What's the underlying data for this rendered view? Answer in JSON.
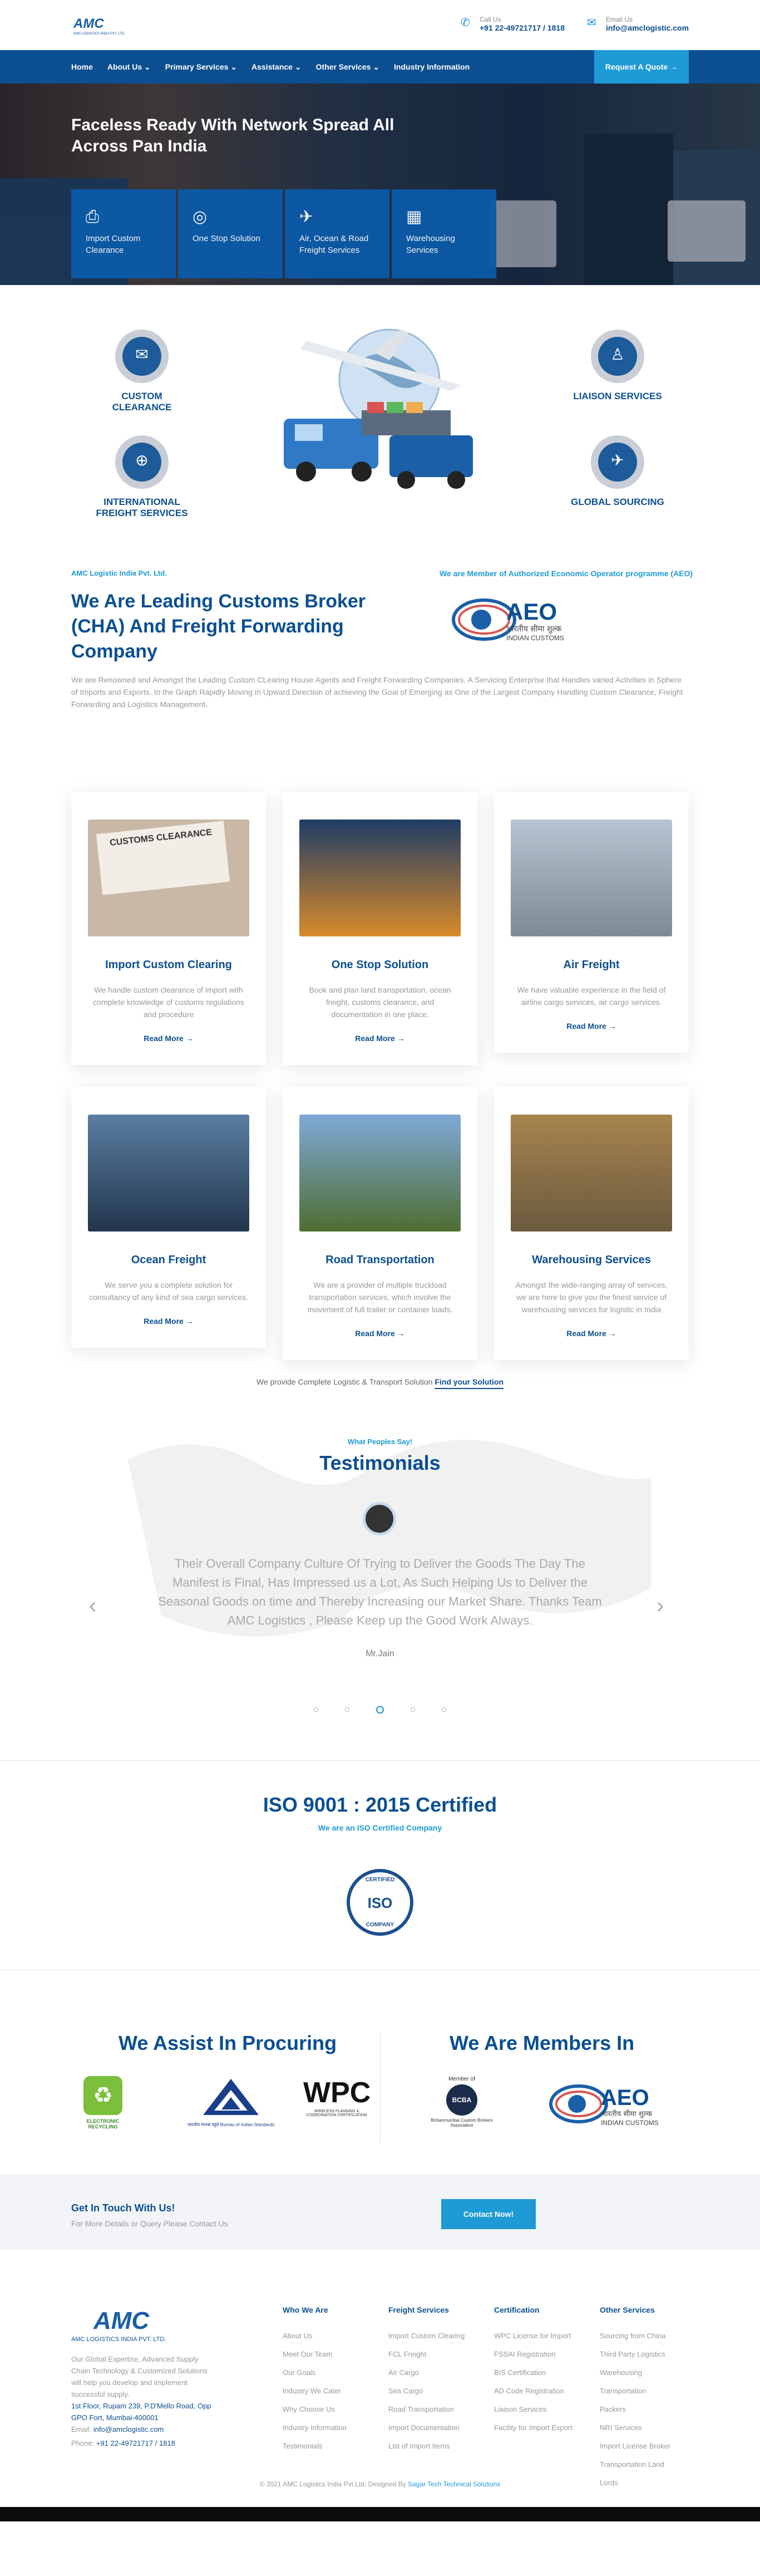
{
  "header": {
    "logo_text": "AMC LOGISTICS INDIA PVT. LTD.",
    "call_label": "Call Us",
    "call_value": "+91 22-49721717 / 1818",
    "email_label": "Email Us",
    "email_value": "info@amclogistic.com"
  },
  "nav": {
    "items": [
      "Home",
      "About Us ⌄",
      "Primary Services ⌄",
      "Assistance ⌄",
      "Other Services ⌄",
      "Industry Information"
    ],
    "quote_button": "Request A Quote →"
  },
  "hero": {
    "title": "Faceless Ready With Network Spread All Across Pan India",
    "boxes": [
      "Import Custom Clearance",
      "One Stop Solution",
      "Air, Ocean & Road Freight Services",
      "Warehousing Services"
    ]
  },
  "badges": {
    "custom": "CUSTOM CLEARANCE",
    "intl": "INTERNATIONAL FREIGHT SERVICES",
    "liaison": "LIAISON SERVICES",
    "global": "GLOBAL SOURCING"
  },
  "about": {
    "tag": "AMC Logistic India Pvt. Ltd.",
    "title": "We Are Leading Customs Broker (CHA) And Freight Forwarding Company",
    "aeo_tag": "We are Member of Authorized Economic Operator programme (AEO)",
    "aeo_text": "AEO",
    "aeo_sub": "भारतीय सीमा शुल्क",
    "aeo_sub2": "INDIAN CUSTOMS",
    "text": "We are Renowned and Amongst the Leading Custom CLearing House Agents and Freight Forwarding Companies. A Servicing Enterprise that Handles varied Activities in Sphere of Imports and Exports. In the Graph Rapidly Moving in Upward Direction of achieving the Goal of Emerging as One of the Largest Company Handling Custom Clearance, Freight Forwarding and Logistics Management."
  },
  "cards": [
    {
      "title": "Import Custom Clearing",
      "text": "We handle custom clearance of import with complete knowledge of customs regulations and procedure",
      "link": "Read More →",
      "img_label": "CUSTOMS CLEARANCE",
      "color": "#c9b8a6"
    },
    {
      "title": "One Stop Solution",
      "text": "Book and plan land transportation, ocean freight, customs clearance, and documentation in one place.",
      "link": "Read More →",
      "img_label": "",
      "color": "#3d5e8a"
    },
    {
      "title": "Air Freight",
      "text": "We have valuable experience in the field of airline cargo services, air cargo services.",
      "link": "Read More →",
      "img_label": "",
      "color": "#9aa7b4"
    },
    {
      "title": "Ocean Freight",
      "text": "We serve you a complete solution for consultancy of any kind of sea cargo services.",
      "link": "Read More →",
      "img_label": "",
      "color": "#3b5b7d"
    },
    {
      "title": "Road Transportation",
      "text": "We are a provider of multiple truckload transportation services, which involve the movement of full trailer or container loads.",
      "link": "Read More →",
      "img_label": "",
      "color": "#566e3c"
    },
    {
      "title": "Warehousing Services",
      "text": "Amongst the wide-ranging array of services, we are here to give you the finest service of warehousing services for logistic in India",
      "link": "Read More →",
      "img_label": "",
      "color": "#9b7b4a"
    }
  ],
  "find": {
    "text": "We provide Complete Logistic & Transport Solution",
    "link": "Find your Solution"
  },
  "testimonials": {
    "tag": "What Peoples Say!",
    "title": "Testimonials",
    "quote": "Their Overall Company Culture Of Trying to Deliver the Goods The Day The Manifest is Final, Has Impressed us a Lot, As Such Helping Us to Deliver the Seasonal Goods on time and Thereby Increasing our Market Share. Thanks Team AMC Logistics , Please Keep up the Good Work Always.",
    "name": "Mr.Jain",
    "prev": "‹",
    "next": "›"
  },
  "iso": {
    "title": "ISO 9001 : 2015 Certified",
    "sub": "We are an ISO Certified Company",
    "seal_top": "CERTIFIED",
    "seal_mid": "ISO",
    "seal_bottom": "COMPANY"
  },
  "assist": {
    "procure_title": "We Assist In Procuring",
    "members_title": "We Are Members In",
    "logo1": "ELECTRONIC RECYCLING",
    "logo2": "भारतीय मानक ब्यूरो Bureau of Indian Standards",
    "logo3": "WPC",
    "logo3_sub": "WIRELESS PLANNING & COORDINATION CERTIFICATION",
    "logo4_top": "Member of",
    "logo4": "BCBA",
    "logo4_sub": "Brihanmumbai Custom Brokers Association",
    "logo5": "AEO",
    "logo5_sub": "भारतीय सीमा शुल्क",
    "logo5_sub2": "INDIAN CUSTOMS"
  },
  "touch": {
    "title": "Get In Touch With Us!",
    "sub": "For More Details or Query Please Contact Us",
    "button": "Contact Now!"
  },
  "footer": {
    "logo_text": "AMC LOGISTICS INDIA PVT. LTD.",
    "about": "Our Global Expertise, Advanced Supply Chain Technology & Customized Solutions will help you develop and implement successful supply.",
    "address": "1st Floor, Rupam 239, P.D'Mello Road, Opp GPO Fort, Mumbai-400001",
    "email_label": "Email:",
    "email": "info@amclogistic.com",
    "phone_label": "Phone:",
    "phone": "+91 22-49721717 / 1818",
    "cols": [
      {
        "title": "Who We Are",
        "items": [
          "About Us",
          "Meet Our Team",
          "Our Goals",
          "Industry We Cater",
          "Why Choose Us",
          "Industry Information",
          "Testimonials"
        ]
      },
      {
        "title": "Freight Services",
        "items": [
          "Import Custom Clearing",
          "FCL Freight",
          "Air Cargo",
          "Sea Cargo",
          "Road Transportation",
          "Import Documentation",
          "List of Import Items"
        ]
      },
      {
        "title": "Certification",
        "items": [
          "WPC License for Import",
          "FSSAI Registration",
          "BIS Certification",
          "AD Code Registration",
          "Liaison Services",
          "Facility for Import Export"
        ]
      },
      {
        "title": "Other Services",
        "items": [
          "Sourcing from China",
          "Third Party Logistics",
          "Warehousing",
          "Transportation",
          "Packers",
          "NRI Services",
          "Import License Broker",
          "Transportation Land",
          "Lords"
        ]
      }
    ],
    "copyright": "© 2021 AMC Logistics India Pvt Ltd. Designed By",
    "designer": "Sagar Tech Technical Solutions"
  }
}
